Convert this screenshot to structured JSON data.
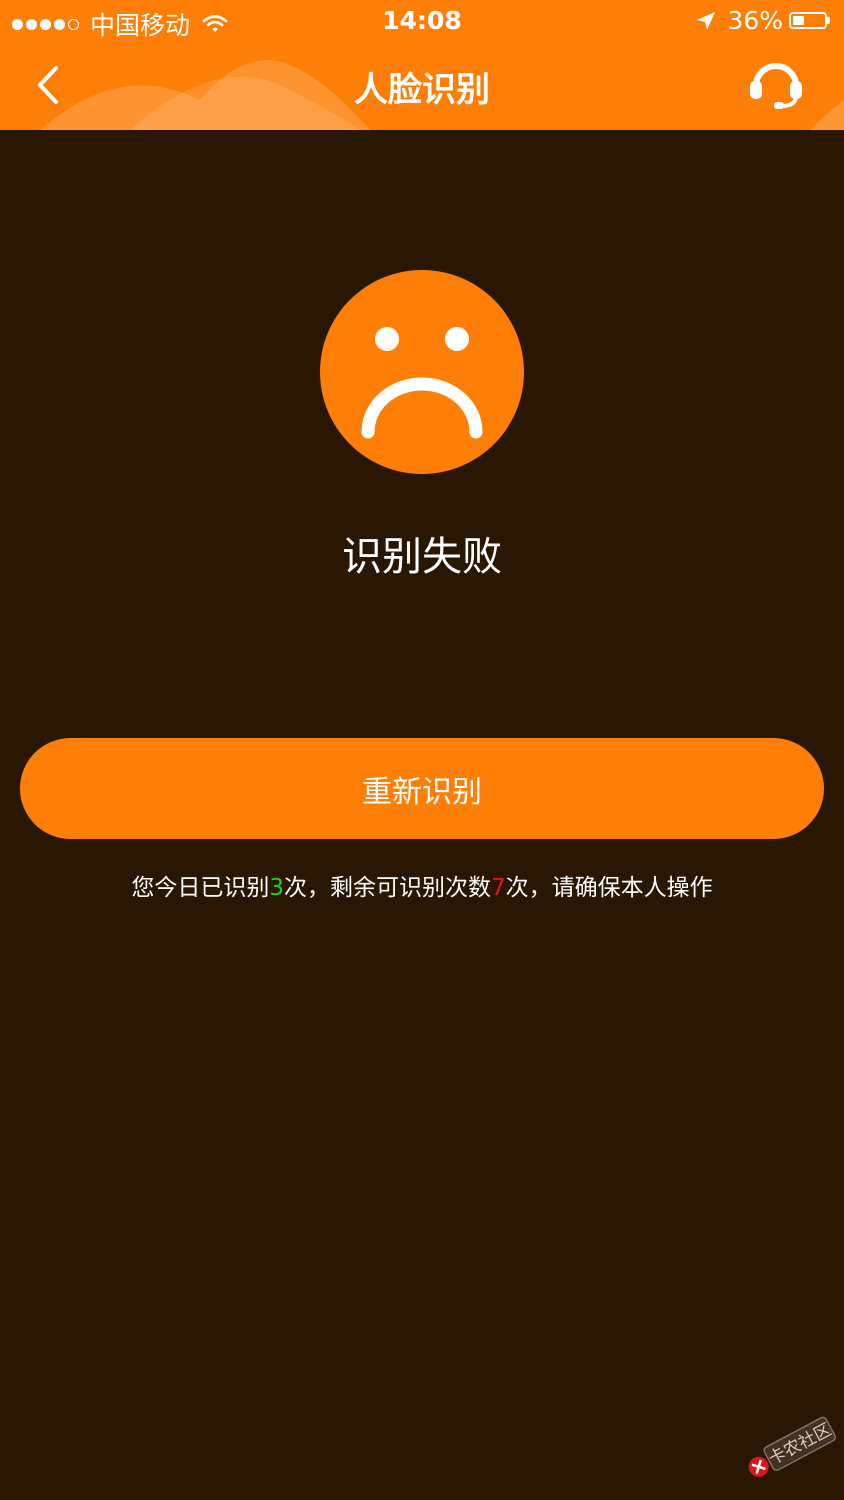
{
  "status_bar": {
    "carrier": "中国移动",
    "time": "14:08",
    "battery_percent_text": "36%",
    "battery_level": 0.36
  },
  "nav": {
    "title": "人脸识别",
    "back_icon": "chevron-left-icon",
    "support_icon": "headset-icon"
  },
  "result": {
    "icon": "sad-face-icon",
    "title": "识别失败"
  },
  "retry_button": {
    "label": "重新识别"
  },
  "hint": {
    "prefix": "您今日已识别",
    "used_count": "3",
    "middle": "次，剩余可识别次数",
    "remaining_count": "7",
    "suffix": "次，请确保本人操作"
  },
  "colors": {
    "brand_orange": "#FE7F08",
    "background": "#291603",
    "used_count_green": "#23d11b",
    "remaining_count_red": "#e0151b"
  },
  "watermark": {
    "text": "卡农社区"
  }
}
